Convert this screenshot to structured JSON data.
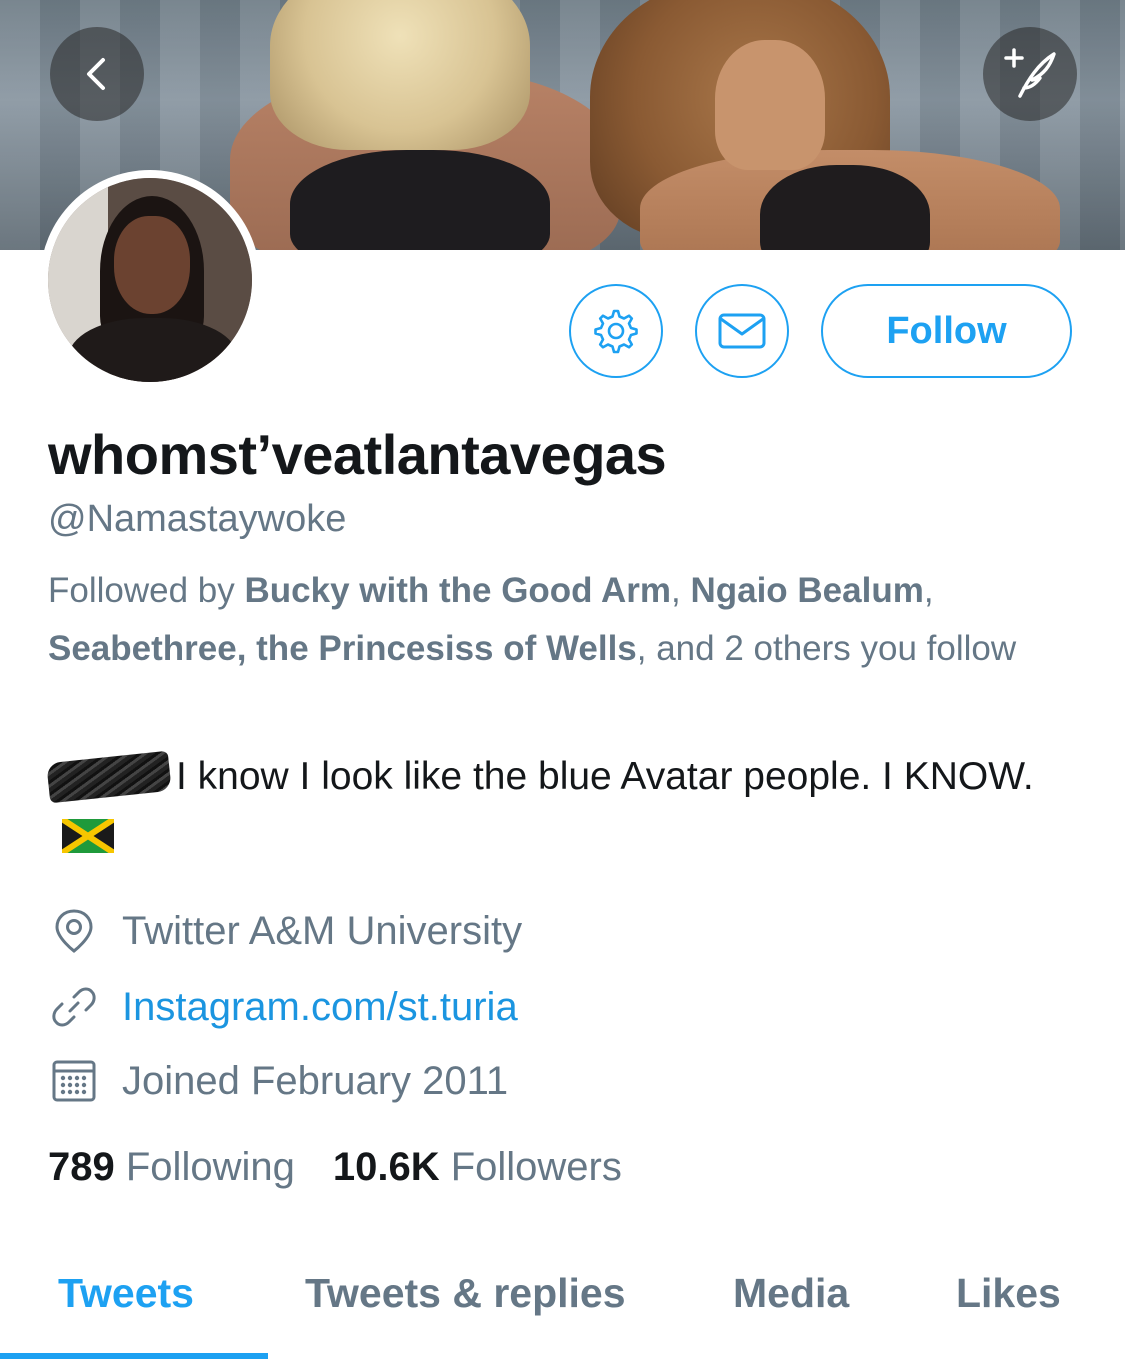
{
  "header": {
    "back_icon": "chevron-left-icon",
    "compose_icon": "compose-tweet-icon"
  },
  "profile": {
    "display_name": "whomst've­atlantavegas",
    "display_name_text": "whomst’veatlantavegas",
    "handle": "@Namastaywoke",
    "follow_label": "Follow",
    "followed_by": {
      "prefix": "Followed by ",
      "names": [
        "Bucky with the Good Arm",
        "Ngaio Bealum",
        "Seabethree, the Princesiss of Wells"
      ],
      "sep": ", ",
      "suffix": ", and 2 others you follow"
    },
    "bio_text": "I know I look like the blue Avatar people. I KNOW.",
    "location": "Twitter A&M University",
    "website": "Instagram.com/st.turia",
    "joined": "Joined February 2011",
    "following_count": "789",
    "following_label": "Following",
    "followers_count": "10.6K",
    "followers_label": "Followers"
  },
  "tabs": [
    {
      "label": "Tweets",
      "active": true
    },
    {
      "label": "Tweets & replies",
      "active": false
    },
    {
      "label": "Media",
      "active": false
    },
    {
      "label": "Likes",
      "active": false
    }
  ],
  "colors": {
    "accent": "#1da1f2",
    "link": "#1b95e0",
    "secondary_text": "#657786",
    "primary_text": "#14171a"
  }
}
